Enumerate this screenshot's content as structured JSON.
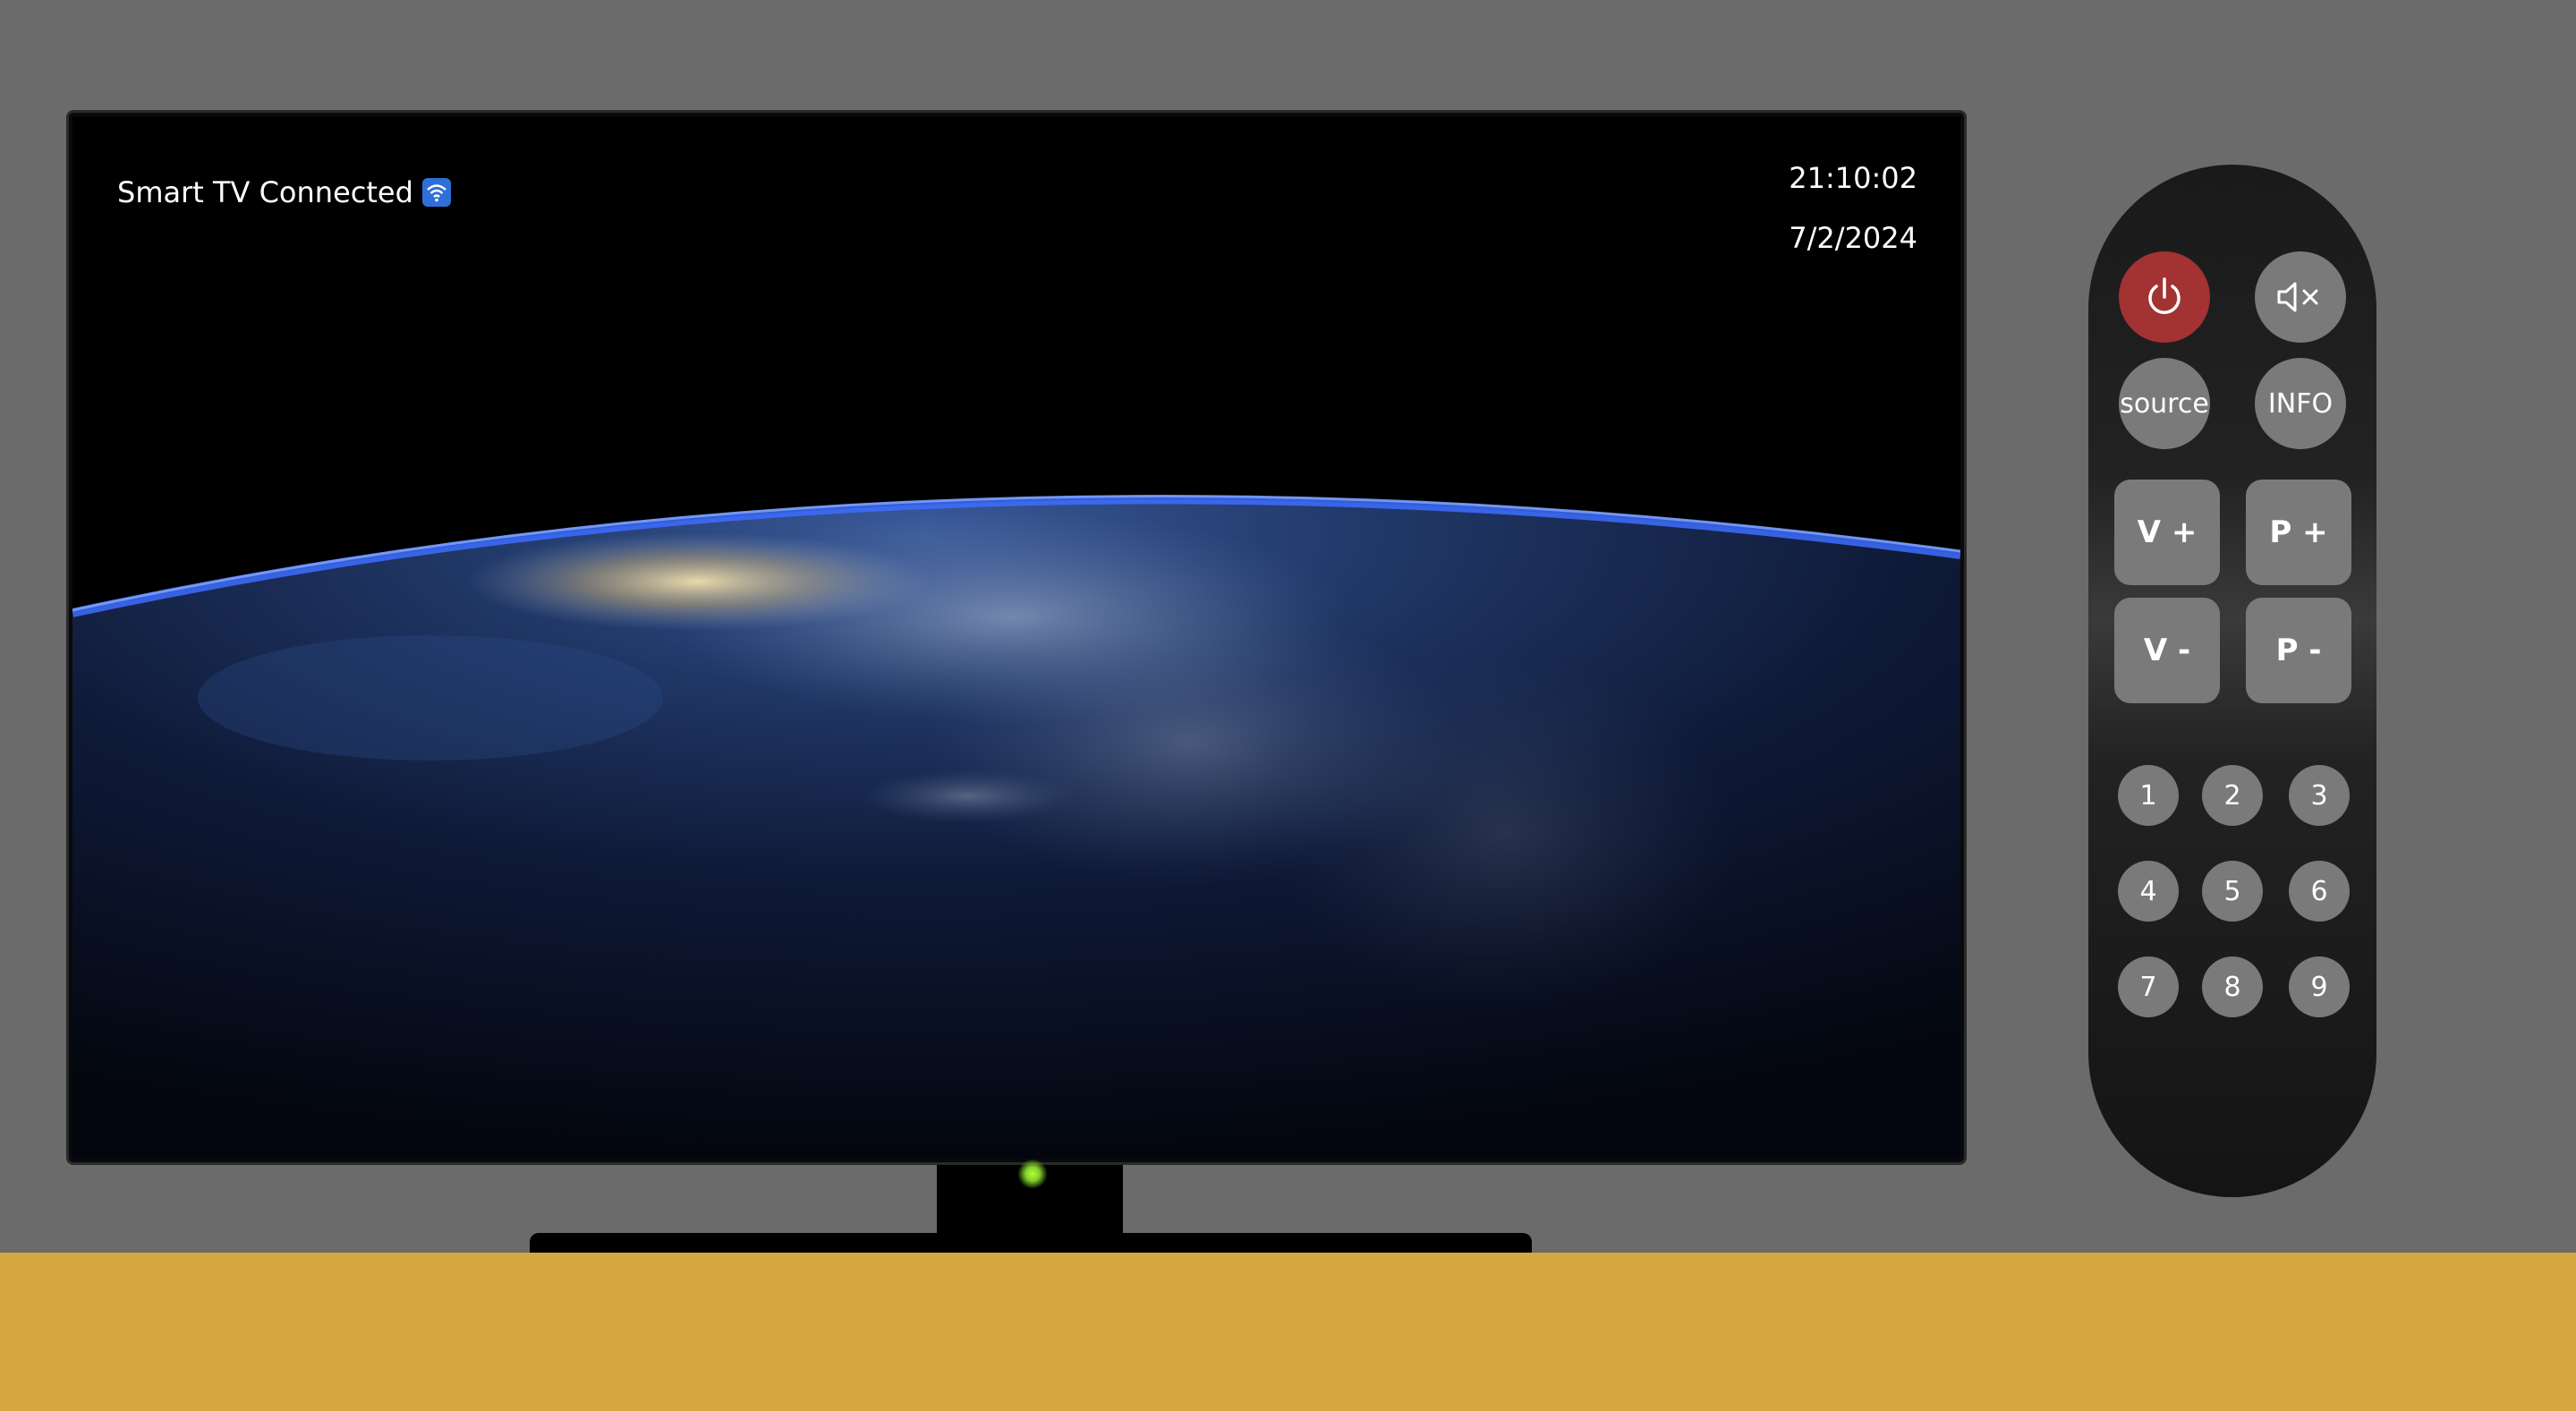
{
  "tv": {
    "status_text": "Smart TV Connected",
    "status_icon": "wifi-icon",
    "time": "21:10:02",
    "date": "7/2/2024",
    "screen_content": "earth-from-space",
    "power_led_color": "#9be635"
  },
  "remote": {
    "power_icon": "power-icon",
    "power_color": "#a33232",
    "mute_icon": "mute-icon",
    "source_label": "source",
    "info_label": "INFO",
    "vol_up_label": "V +",
    "vol_down_label": "V -",
    "prog_up_label": "P +",
    "prog_down_label": "P -",
    "numbers": [
      "1",
      "2",
      "3",
      "4",
      "5",
      "6",
      "7",
      "8",
      "9"
    ]
  },
  "colors": {
    "wall": "#6b6b6b",
    "floor": "#d4a83f",
    "button": "#7a7a7a"
  }
}
